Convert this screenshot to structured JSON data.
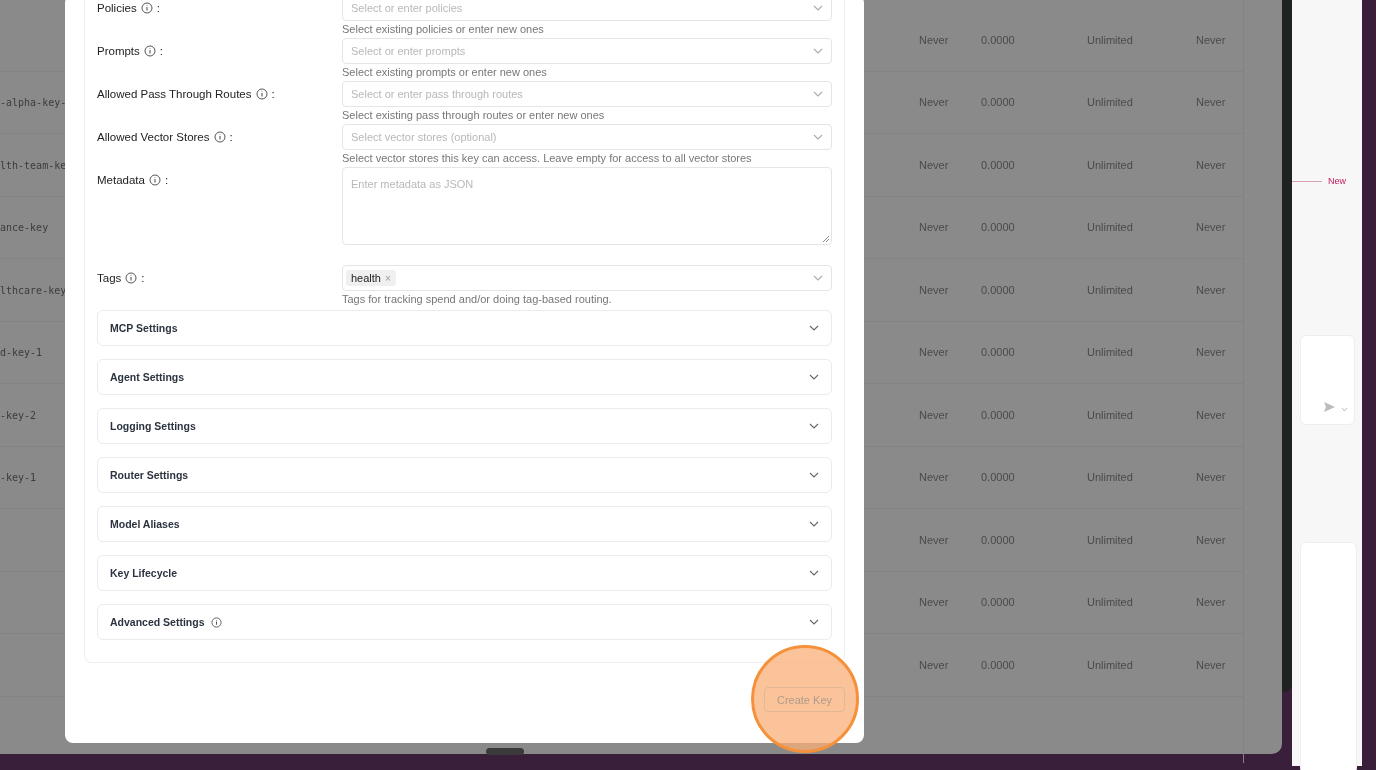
{
  "background_table": {
    "name_cells": [
      "",
      "-alpha-key-",
      "lth-team-ke",
      "ance-key",
      "lthcare-key",
      "d-key-1",
      "-key-2",
      "-key-1",
      "",
      "",
      ""
    ],
    "rows": [
      {
        "expires": "Never",
        "spend": "0.0000",
        "budget": "Unlimited",
        "reset": "Never"
      },
      {
        "expires": "Never",
        "spend": "0.0000",
        "budget": "Unlimited",
        "reset": "Never"
      },
      {
        "expires": "Never",
        "spend": "0.0000",
        "budget": "Unlimited",
        "reset": "Never"
      },
      {
        "expires": "Never",
        "spend": "0.0000",
        "budget": "Unlimited",
        "reset": "Never"
      },
      {
        "expires": "Never",
        "spend": "0.0000",
        "budget": "Unlimited",
        "reset": "Never"
      },
      {
        "expires": "Never",
        "spend": "0.0000",
        "budget": "Unlimited",
        "reset": "Never"
      },
      {
        "expires": "Never",
        "spend": "0.0000",
        "budget": "Unlimited",
        "reset": "Never"
      },
      {
        "expires": "Never",
        "spend": "0.0000",
        "budget": "Unlimited",
        "reset": "Never"
      },
      {
        "expires": "Never",
        "spend": "0.0000",
        "budget": "Unlimited",
        "reset": "Never"
      },
      {
        "expires": "Never",
        "spend": "0.0000",
        "budget": "Unlimited",
        "reset": "Never"
      },
      {
        "expires": "Never",
        "spend": "0.0000",
        "budget": "Unlimited",
        "reset": "Never"
      }
    ]
  },
  "side_panel": {
    "new_label": "New"
  },
  "modal": {
    "fields": [
      {
        "kind": "select",
        "label": "Policies",
        "label_end": ":",
        "placeholder": "Select or enter policies",
        "help": "Select existing policies or enter new ones"
      },
      {
        "kind": "select",
        "label": "Prompts",
        "label_end": ":",
        "placeholder": "Select or enter prompts",
        "help": "Select existing prompts or enter new ones"
      },
      {
        "kind": "select",
        "label": "Allowed Pass Through Routes",
        "label_end": ":",
        "placeholder": "Select or enter pass through routes",
        "help": "Select existing pass through routes or enter new ones"
      },
      {
        "kind": "select",
        "label": "Allowed Vector Stores",
        "label_end": ":",
        "placeholder": "Select vector stores (optional)",
        "help": "Select vector stores this key can access. Leave empty for access to all vector stores"
      },
      {
        "kind": "textarea",
        "label": "Metadata",
        "label_end": ":",
        "placeholder": "Enter metadata as JSON"
      },
      {
        "kind": "tags",
        "label": "Tags",
        "label_end": ":",
        "tags": [
          "health"
        ],
        "tag_remove": "×",
        "help": "Tags for tracking spend and/or doing tag-based routing."
      }
    ],
    "sections": [
      {
        "title": "MCP Settings",
        "info": false,
        "expanded": false
      },
      {
        "title": "Agent Settings",
        "info": false,
        "expanded": false
      },
      {
        "title": "Logging Settings",
        "info": false,
        "expanded": false
      },
      {
        "title": "Router Settings",
        "info": false,
        "expanded": false
      },
      {
        "title": "Model Aliases",
        "info": false,
        "expanded": false
      },
      {
        "title": "Key Lifecycle",
        "info": false,
        "expanded": false
      },
      {
        "title": "Advanced Settings",
        "info": true,
        "expanded": false
      }
    ],
    "submit": {
      "label": "Create Key",
      "disabled": true,
      "highlighted": true
    }
  }
}
